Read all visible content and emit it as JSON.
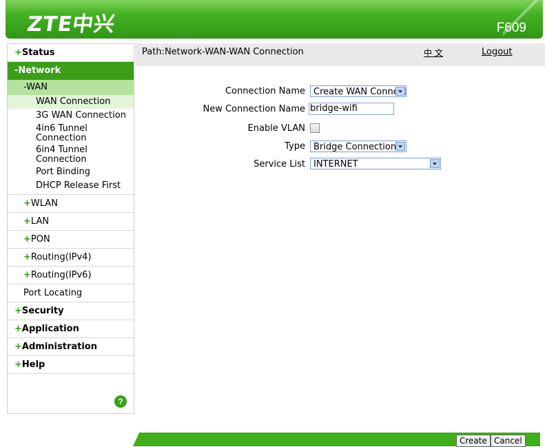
{
  "header": {
    "logo_text": "ZTE中兴",
    "model": "F609"
  },
  "topbar": {
    "path": "Path:Network-WAN-WAN Connection",
    "language": "中 文",
    "logout": "Logout"
  },
  "sidebar": {
    "status": "Status",
    "network": "-Network",
    "wan": "-WAN",
    "wan_items": [
      "WAN Connection",
      "3G WAN Connection",
      "4in6 Tunnel Connection",
      "6in4 Tunnel Connection",
      "Port Binding",
      "DHCP Release First"
    ],
    "network_items": [
      "WLAN",
      "LAN",
      "PON",
      "Routing(IPv4)",
      "Routing(IPv6)",
      "Port Locating"
    ],
    "security": "Security",
    "application": "Application",
    "administration": "Administration",
    "help": "Help",
    "help_icon": "?"
  },
  "form": {
    "connection_name_label": "Connection Name",
    "connection_name_value": "Create WAN Connection",
    "new_connection_name_label": "New Connection Name",
    "new_connection_name_value": "bridge-wifi",
    "enable_vlan_label": "Enable VLAN",
    "type_label": "Type",
    "type_value": "Bridge Connection",
    "service_list_label": "Service List",
    "service_list_value": "INTERNET"
  },
  "buttons": {
    "create": "Create",
    "cancel": "Cancel"
  },
  "colors": {
    "brand_green": "#3a9f16",
    "submenu_green": "#b4e39e"
  }
}
